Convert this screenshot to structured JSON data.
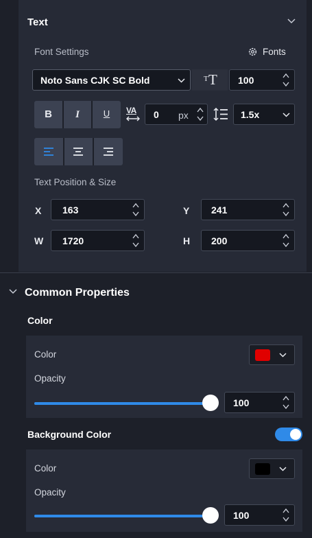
{
  "text_section": {
    "title": "Text",
    "font_settings_label": "Font Settings",
    "fonts_button": "Fonts",
    "font_family": "Noto Sans CJK SC Bold",
    "font_size": "100",
    "bold": "B",
    "italic": "I",
    "underline": "U",
    "letter_spacing": "0",
    "letter_spacing_unit": "px",
    "line_height": "1.5x",
    "position_size_label": "Text Position & Size",
    "x_label": "X",
    "x_value": "163",
    "y_label": "Y",
    "y_value": "241",
    "w_label": "W",
    "w_value": "1720",
    "h_label": "H",
    "h_value": "200"
  },
  "common": {
    "title": "Common Properties",
    "color_section_label": "Color",
    "color_label": "Color",
    "color_swatch": "#e00000",
    "opacity_label": "Opacity",
    "opacity_value": "100",
    "opacity_fraction": 1.0,
    "background_color_label": "Background Color",
    "background_enabled": true,
    "bg_color_label": "Color",
    "bg_color_swatch": "#000000",
    "bg_opacity_label": "Opacity",
    "bg_opacity_value": "100",
    "bg_opacity_fraction": 1.0
  },
  "colors": {
    "accent": "#2f8ae8",
    "panel": "#262a36",
    "background": "#1d2029"
  }
}
